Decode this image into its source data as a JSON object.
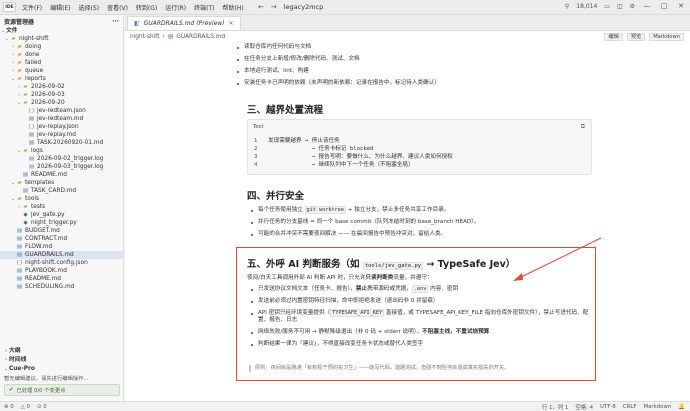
{
  "titlebar": {
    "logo": "IDE",
    "menu": [
      "文件(F)",
      "编辑(E)",
      "选择(S)",
      "查看(V)",
      "转到(G)",
      "运行(R)",
      "终端(T)",
      "帮助(H)"
    ],
    "nav_back": "←",
    "nav_forward": "→",
    "project": "legacy2mcp",
    "token_count": "18,014",
    "window_min": "—",
    "window_max": "□",
    "window_close": "✕"
  },
  "sidebar": {
    "title": "资源管理器",
    "section_files": "文件",
    "tree": [
      {
        "label": "night-shift",
        "type": "folder",
        "depth": 0,
        "open": true
      },
      {
        "label": "doing",
        "type": "folder",
        "depth": 1,
        "open": false
      },
      {
        "label": "done",
        "type": "folder",
        "depth": 1,
        "open": false
      },
      {
        "label": "failed",
        "type": "folder",
        "depth": 1,
        "open": false
      },
      {
        "label": "queue",
        "type": "folder",
        "depth": 1,
        "open": false
      },
      {
        "label": "reports",
        "type": "folder",
        "depth": 1,
        "open": true
      },
      {
        "label": "2026-09-02",
        "type": "folder",
        "depth": 2,
        "open": false
      },
      {
        "label": "2026-09-03",
        "type": "folder",
        "depth": 2,
        "open": false
      },
      {
        "label": "2026-09-20",
        "type": "folder",
        "depth": 2,
        "open": true
      },
      {
        "label": "jev-redteam.json",
        "type": "json",
        "depth": 3
      },
      {
        "label": "jev-redteam.md",
        "type": "md",
        "depth": 3
      },
      {
        "label": "jev-replay.json",
        "type": "json",
        "depth": 3
      },
      {
        "label": "jev-replay.md",
        "type": "md",
        "depth": 3
      },
      {
        "label": "TASK-20260920-01.md",
        "type": "md",
        "depth": 3
      },
      {
        "label": "logs",
        "type": "folder",
        "depth": 2,
        "open": true
      },
      {
        "label": "2026-09-02_trigger.log",
        "type": "file",
        "depth": 3
      },
      {
        "label": "2026-09-03_trigger.log",
        "type": "file",
        "depth": 3
      },
      {
        "label": "README.md",
        "type": "md",
        "depth": 2
      },
      {
        "label": "templates",
        "type": "folder",
        "depth": 1,
        "open": true
      },
      {
        "label": "TASK_CARD.md",
        "type": "md",
        "depth": 2
      },
      {
        "label": "tools",
        "type": "folder",
        "depth": 1,
        "open": true
      },
      {
        "label": "tests",
        "type": "folder",
        "depth": 2,
        "open": false
      },
      {
        "label": "jev_gate.py",
        "type": "py",
        "depth": 2
      },
      {
        "label": "night_trigger.py",
        "type": "py",
        "depth": 2
      },
      {
        "label": "BUDGET.md",
        "type": "md",
        "depth": 1
      },
      {
        "label": "CONTRACT.md",
        "type": "md",
        "depth": 1
      },
      {
        "label": "FLOW.md",
        "type": "md",
        "depth": 1
      },
      {
        "label": "GUARDRAILS.md",
        "type": "md",
        "depth": 1,
        "selected": true
      },
      {
        "label": "night-shift.config.json",
        "type": "json",
        "depth": 1
      },
      {
        "label": "PLAYBOOK.md",
        "type": "md",
        "depth": 1
      },
      {
        "label": "README.md",
        "type": "md",
        "depth": 1
      },
      {
        "label": "SCHEDULING.md",
        "type": "md",
        "depth": 1
      }
    ],
    "section_outline": "大纲",
    "section_timeline": "时间线",
    "cue_title": "Cue-Pro",
    "cue_desc": "暂无编辑建议，请先进行编辑操作...",
    "cue_status": "已处理 0/0 个变更点"
  },
  "tab": {
    "title": "GUARDRAILS.md (Preview)",
    "close": "✕"
  },
  "breadcrumb": {
    "parts": [
      "night-shift",
      "GUARDRAILS.md"
    ],
    "sep": "›",
    "buttons": [
      "编辑",
      "预览",
      "Markdown"
    ]
  },
  "doc": {
    "bullets_top": [
      "读取仓库内任何代码与文档",
      "在任务分支上新增/修改/删除代码、测试、文档",
      "本地运行测试、lint、构建",
      "安装任务卡已声明的依赖（未声明的新依赖：记录在报告中，标记待人类确认）"
    ],
    "h_escalation": "三、越界处置流程",
    "code": {
      "lang": "Text",
      "copy": "⧉",
      "lines": [
        {
          "n": "1",
          "t": "发现需要越界 → 停止该任务"
        },
        {
          "n": "2",
          "t": "             → 任务卡标记 blocked"
        },
        {
          "n": "3",
          "t": "             → 报告写明：要做什么、为什么越界、建议人类如何授权"
        },
        {
          "n": "4",
          "t": "             → 继续队列中下一个任务（不阻塞全局）"
        }
      ]
    },
    "h_parallel": "四、并行安全",
    "parallel": [
      {
        "pre": "每个任务使用独立 ",
        "code": "git worktree",
        "post": " + 独立分支，禁止多任务共享工作目录。"
      },
      {
        "pre": "并行任务的分支基线 = 同一个 base commit（队列冻结时刻的 base_branch HEAD）。",
        "code": "",
        "post": ""
      },
      {
        "pre": "可能的合并冲突不需要夜间解决 —— 在晨间报告中预告冲突对，留给人类。",
        "code": "",
        "post": ""
      }
    ],
    "h_jev_pre": "五、外呼 AI 判断服务（如 ",
    "h_jev_code": "tools/jev_gate.py",
    "h_jev_post": " → TypeSafe Jev）",
    "jev_intro_a": "夜间/白天工具调用外部 AI 判断 API 时，只允许",
    "jev_intro_b": "只读判断类",
    "jev_intro_c": "流量，并遵守：",
    "jev_items": [
      {
        "a": "只发送协议文档文本（任务卡、报告），",
        "b": "禁止",
        "c": "携带源码或凭据，",
        "code": ".env",
        "d": " 内容、密钥"
      },
      {
        "a": "发送前必须过内置密钥特征扫描，命中即拒绝发送（退出码非 0 并留痕）",
        "b": "",
        "c": "",
        "code": "",
        "d": ""
      },
      {
        "a": "API 密钥只经环境变量提供（",
        "b": "",
        "c": "",
        "code": "TYPESAFE_API_KEY",
        "d": " 直接值，或 TYPESAFE_API_KEY_FILE 指向仓库外密钥文件），禁止写进代码、配置、报告、日志"
      },
      {
        "a": "网络失败/服务不可用 → 静默降级退出（非 0 码 + stderr 说明），",
        "b": "不阻塞主线，不重试烧预算",
        "c": "",
        "code": "",
        "d": ""
      },
      {
        "a": "判断结果一律为「建议」，不得直接改变任务卡状态或替代人类签字",
        "b": "",
        "c": "",
        "code": "",
        "d": ""
      }
    ],
    "jev_quote": "原则：夜间就是跑通「有积极干预的实习生」——能写代码，能跑测试，但碰不到任何会造成真实损失的开关。"
  },
  "statusbar": {
    "left": [
      "⊗ 0",
      "△ 0",
      "⊙ 0"
    ],
    "right": [
      "行 1，列 1",
      "空格: 4",
      "UTF-8",
      "CRLF",
      "Markdown",
      "🔔"
    ]
  }
}
